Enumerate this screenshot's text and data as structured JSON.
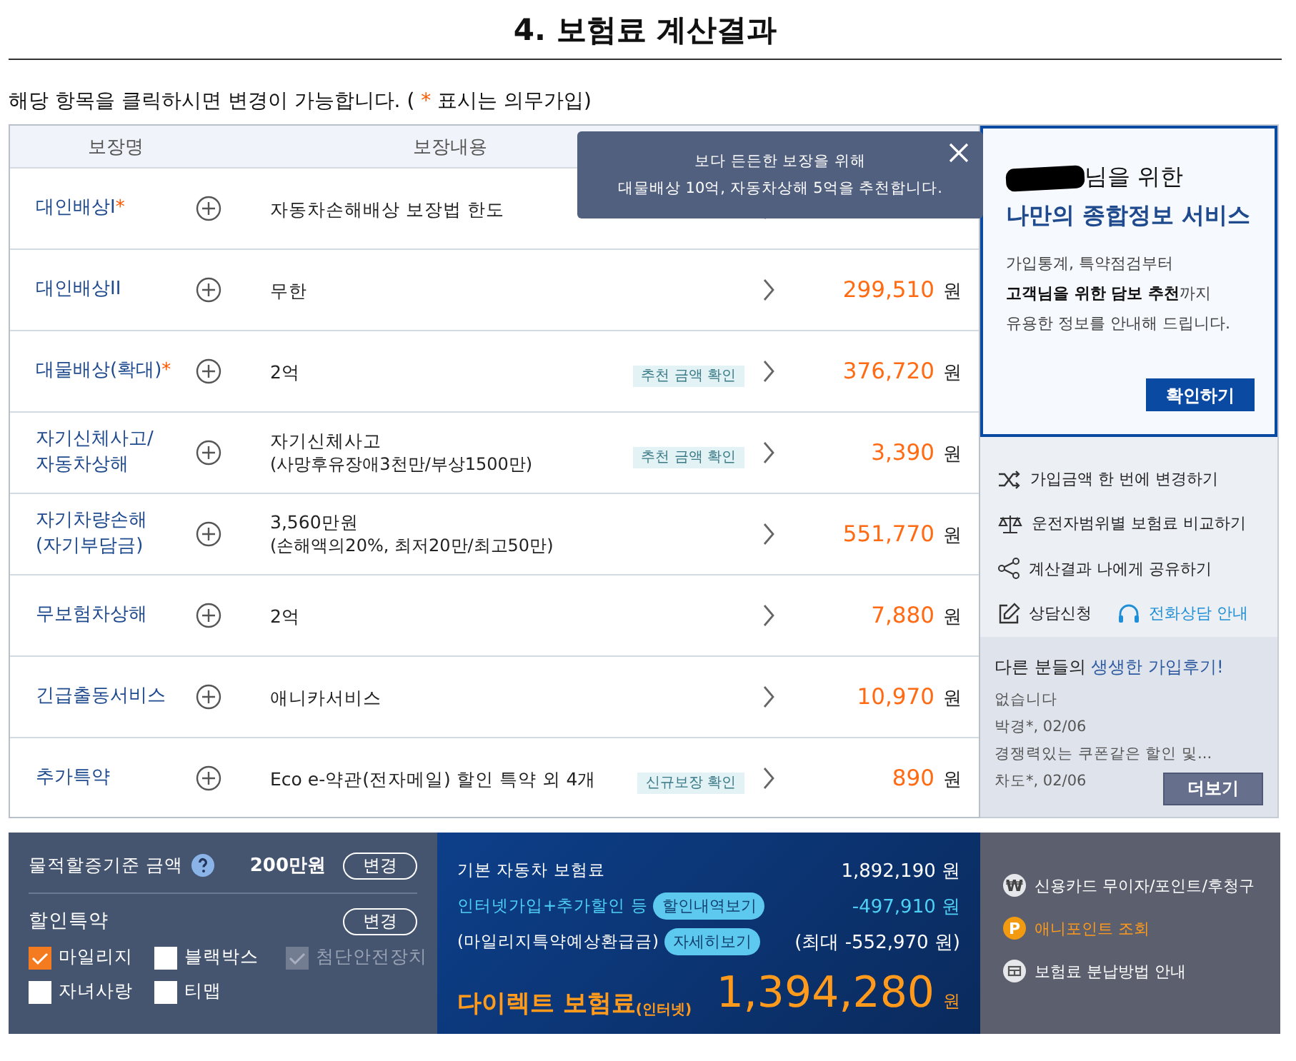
{
  "page_title": "4. 보험료 계산결과",
  "notice": {
    "text_before": "해당 항목을 클릭하시면 변경이 가능합니다. (",
    "mark": "*",
    "text_after": "표시는 의무가입)"
  },
  "coverage_table": {
    "columns": [
      "보장명",
      "보장내용"
    ],
    "rows": [
      {
        "name_lines": [
          "대인배상I"
        ],
        "mark": "*",
        "detail": "자동차손해배상 보장법 한도"
      },
      {
        "name_lines": [
          "대인배상II"
        ],
        "detail": "무한",
        "price": "299,510",
        "unit": "원"
      },
      {
        "name_lines": [
          "대물배상(확대)"
        ],
        "mark": "*",
        "detail": "2억",
        "badge": "추천 금액 확인",
        "price": "376,720",
        "unit": "원"
      },
      {
        "name_lines": [
          "자기신체사고/",
          "자동차상해"
        ],
        "detail": "자기신체사고",
        "detail_sub": "(사망후유장애3천만/부상1500만)",
        "badge": "추천 금액 확인",
        "price": "3,390",
        "unit": "원"
      },
      {
        "name_lines": [
          "자기차량손해",
          "(자기부담금)"
        ],
        "detail": "3,560만원",
        "detail_sub": "(손해액의20%, 최저20만/최고50만)",
        "price": "551,770",
        "unit": "원"
      },
      {
        "name_lines": [
          "무보험차상해"
        ],
        "detail": "2억",
        "price": "7,880",
        "unit": "원"
      },
      {
        "name_lines": [
          "긴급출동서비스"
        ],
        "detail": "애니카서비스",
        "price": "10,970",
        "unit": "원"
      },
      {
        "name_lines": [
          "추가특약"
        ],
        "detail": "Eco e-약관(전자메일) 할인 특약 외 4개",
        "badge": "신규보장 확인",
        "price": "890",
        "unit": "원"
      }
    ]
  },
  "tooltip": {
    "lines": [
      "보다 든든한 보장을 위해",
      "대물배상 10억, 자동차상해 5억을 추천합니다."
    ]
  },
  "promo": {
    "greeting": "님을 위한",
    "title": "나만의 종합정보 서비스",
    "body_lines": [
      "가입통계, 특약점검부터",
      "**고객님을 위한 담보 추천**까지",
      "유용한 정보를 안내해 드립니다."
    ],
    "button": "확인하기"
  },
  "quick_links": [
    {
      "kind": "shuffle",
      "label": "가입금액 한 번에 변경하기"
    },
    {
      "kind": "scale",
      "label": "운전자범위별 보험료 비교하기"
    },
    {
      "kind": "share",
      "label": "계산결과 나에게 공유하기"
    }
  ],
  "contact_links": [
    {
      "kind": "pencil",
      "label": "상담신청"
    },
    {
      "kind": "headset",
      "label": "전화상담 안내"
    }
  ],
  "reviews": {
    "title_start": "다른 분들의",
    "title_end": "생생한 가입후기!",
    "items": [
      {
        "text": "없습니다",
        "meta": "박경*, 02/06"
      },
      {
        "text": "경쟁력있는 쿠폰같은 할인 및...",
        "meta": "차도*, 02/06"
      }
    ],
    "button": "더보기"
  },
  "damage_threshold": {
    "label": "물적할증기준 금액",
    "value": "200만원",
    "button": "변경"
  },
  "discount_options": {
    "title": "할인특약",
    "button": "변경",
    "options": [
      {
        "label": "마일리지",
        "checked": true,
        "disabled": false
      },
      {
        "label": "블랙박스",
        "checked": false,
        "disabled": false
      },
      {
        "label": "첨단안전장치",
        "checked": true,
        "disabled": true
      },
      {
        "label": "자녀사랑",
        "checked": false,
        "disabled": false
      },
      {
        "label": "티맵",
        "checked": false,
        "disabled": false
      }
    ]
  },
  "premium_summary": {
    "base": {
      "label": "기본 자동차 보험료",
      "amount": "1,892,190 원"
    },
    "discount": {
      "label": "인터넷가입+추가할인 등",
      "button": "할인내역보기",
      "amount": "-497,910 원"
    },
    "mileage": {
      "label": "(마일리지특약예상환급금)",
      "button": "자세히보기",
      "amount": "(최대 -552,970 원)"
    },
    "total": {
      "label": "다이렉트 보험료",
      "label_sub": "(인터넷)",
      "amount": "1,394,280",
      "unit": "원"
    }
  },
  "payment_links": [
    {
      "kind": "glyph",
      "glyph": "₩",
      "label": "신용카드 무이자/포인트/후청구",
      "highlight": false
    },
    {
      "kind": "glyph",
      "glyph": "P",
      "label": "애니포인트 조회",
      "highlight": true
    },
    {
      "kind": "table",
      "label": "보험료 분납방법 안내",
      "highlight": false
    }
  ]
}
